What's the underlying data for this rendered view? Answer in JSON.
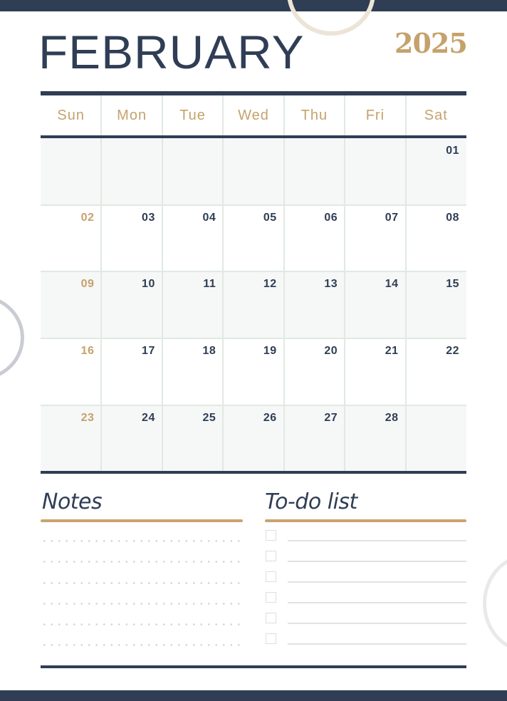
{
  "calendar": {
    "month": "FEBRUARY",
    "year": "2025",
    "weekdays": [
      "Sun",
      "Mon",
      "Tue",
      "Wed",
      "Thu",
      "Fri",
      "Sat"
    ],
    "weeks": [
      [
        "",
        "",
        "",
        "",
        "",
        "",
        "01"
      ],
      [
        "02",
        "03",
        "04",
        "05",
        "06",
        "07",
        "08"
      ],
      [
        "09",
        "10",
        "11",
        "12",
        "13",
        "14",
        "15"
      ],
      [
        "16",
        "17",
        "18",
        "19",
        "20",
        "21",
        "22"
      ],
      [
        "23",
        "24",
        "25",
        "26",
        "27",
        "28",
        ""
      ]
    ]
  },
  "notes": {
    "title": "Notes",
    "line_count": 6
  },
  "todo": {
    "title": "To-do list",
    "items": [
      {
        "checked": false,
        "text": ""
      },
      {
        "checked": false,
        "text": ""
      },
      {
        "checked": false,
        "text": ""
      },
      {
        "checked": false,
        "text": ""
      },
      {
        "checked": false,
        "text": ""
      },
      {
        "checked": false,
        "text": ""
      }
    ]
  },
  "colors": {
    "navy": "#2f3e55",
    "gold": "#c5a26c",
    "grid_line": "#e0e9e2",
    "shade": "#f6f7f7"
  }
}
